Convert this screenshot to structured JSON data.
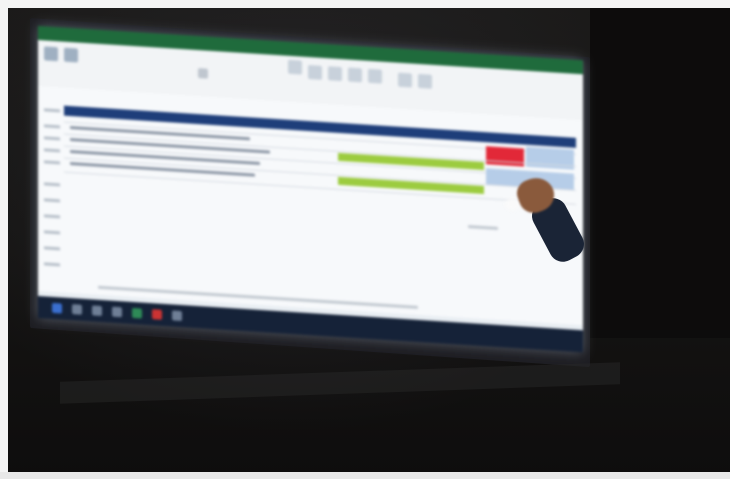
{
  "scene": {
    "description_label": "",
    "screen": {
      "app": "spreadsheet",
      "ribbon_icon_count": 14,
      "rows": [
        {
          "label": "",
          "status": "header"
        },
        {
          "label": "",
          "status": "red"
        },
        {
          "label": "",
          "status": "green"
        },
        {
          "label": "",
          "status": "green"
        }
      ]
    }
  },
  "colors": {
    "title_bar": "#1f6b3c",
    "header_band": "#1e3e7a",
    "green_status": "#9ccc3f",
    "red_status": "#e22838",
    "blue_status": "#b6cde8",
    "taskbar": "#152238"
  },
  "icons": [
    "pointing-hand-icon"
  ]
}
